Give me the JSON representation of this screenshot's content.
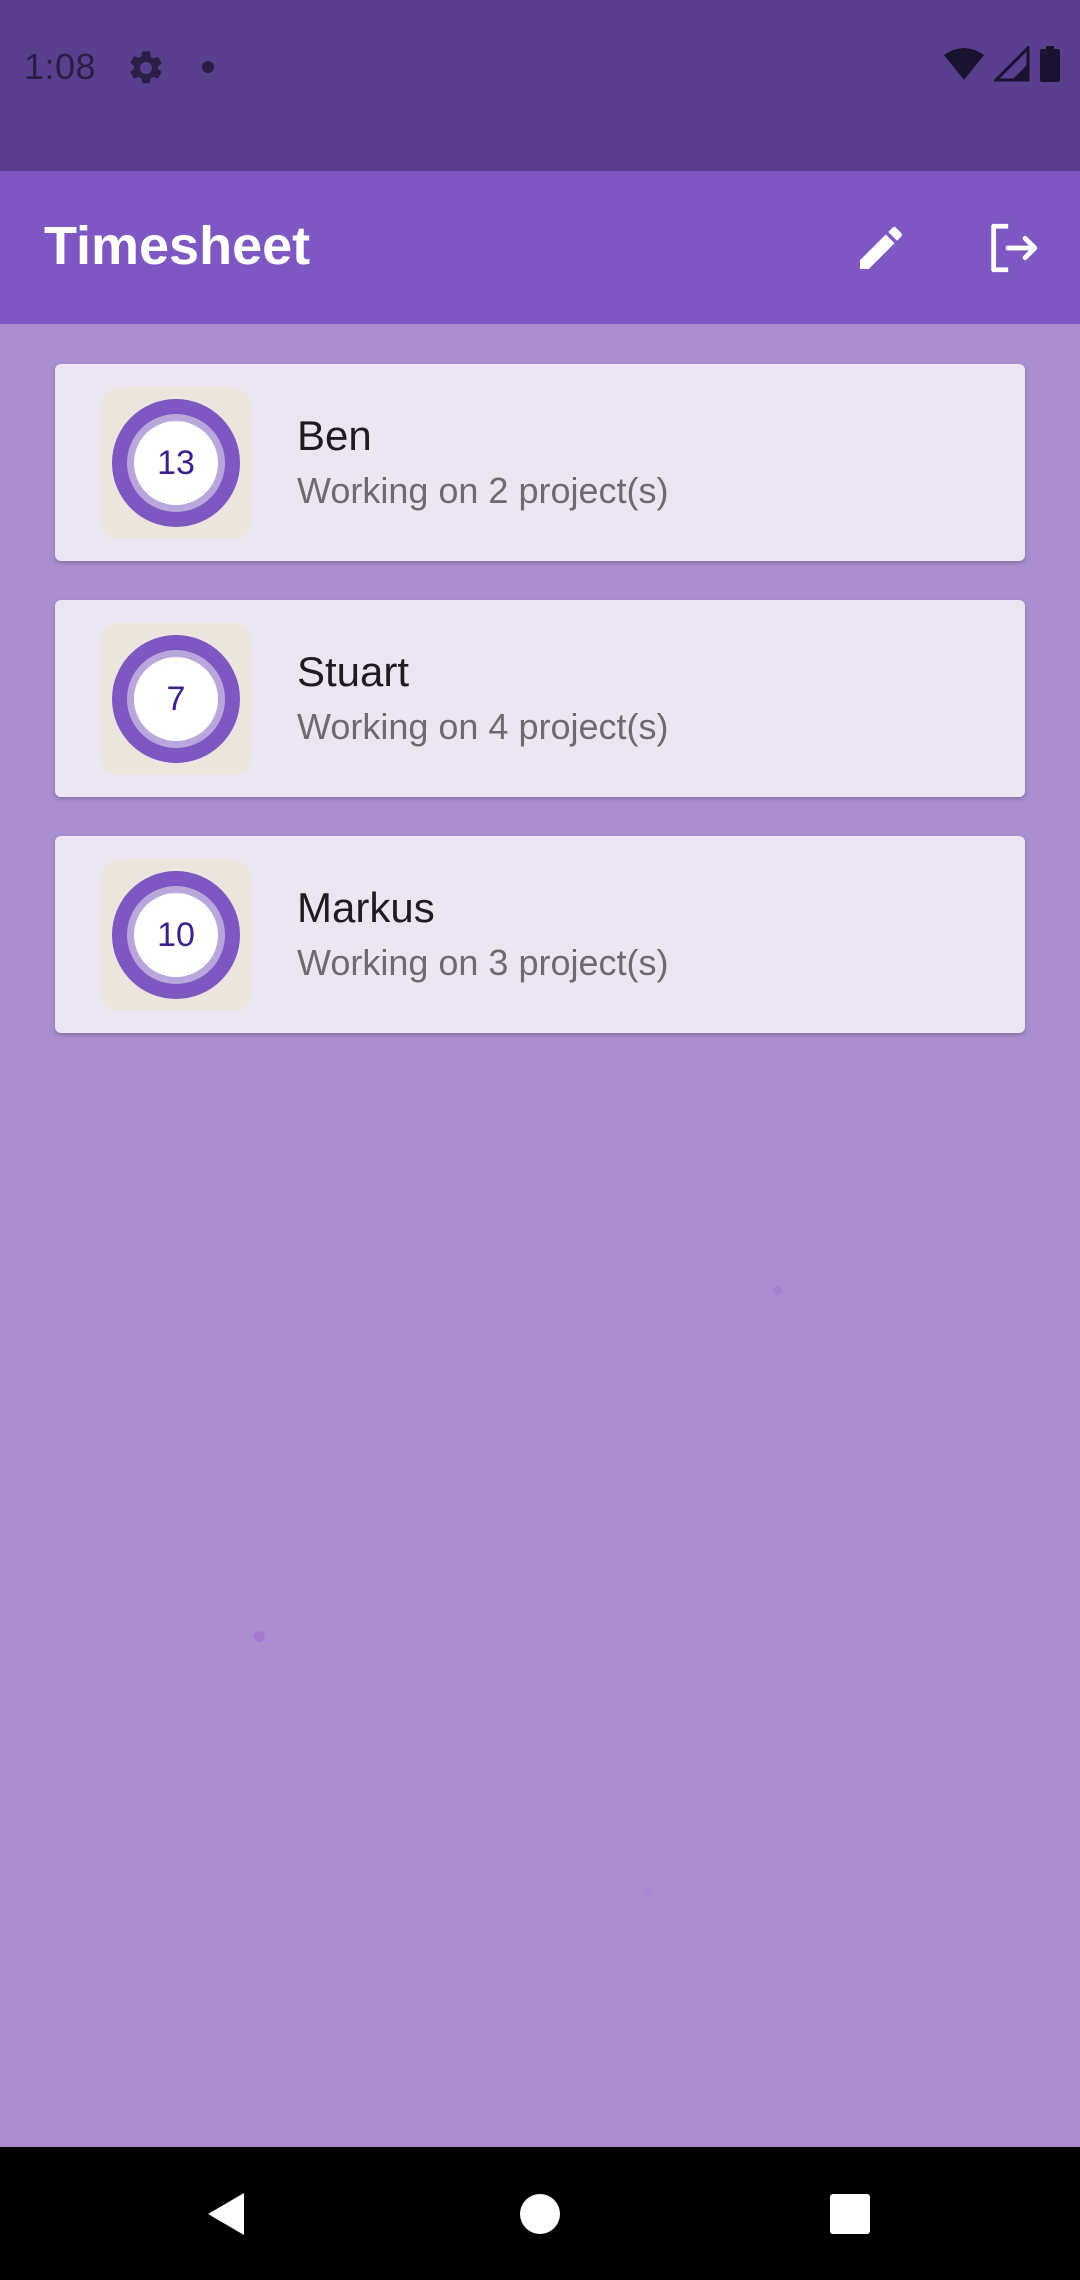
{
  "status_bar": {
    "time": "1:08",
    "icons": [
      "gear-icon",
      "notification-dot-icon",
      "wifi-icon",
      "signal-icon",
      "battery-icon"
    ]
  },
  "app_bar": {
    "title": "Timesheet",
    "actions": [
      "edit-icon",
      "logout-icon"
    ]
  },
  "employees": [
    {
      "badge": "13",
      "name": "Ben",
      "subtitle": "Working on 2 project(s)"
    },
    {
      "badge": "7",
      "name": "Stuart",
      "subtitle": "Working on 4 project(s)"
    },
    {
      "badge": "10",
      "name": "Markus",
      "subtitle": "Working on 3 project(s)"
    }
  ],
  "nav_bar": {
    "buttons": [
      "back-icon",
      "home-icon",
      "recents-icon"
    ]
  },
  "colors": {
    "status_bar": "#5b3f8f",
    "app_bar": "#7e57c2",
    "background": "#ab8ed0",
    "card": "#ece6f3",
    "accent": "#7e57c2"
  }
}
